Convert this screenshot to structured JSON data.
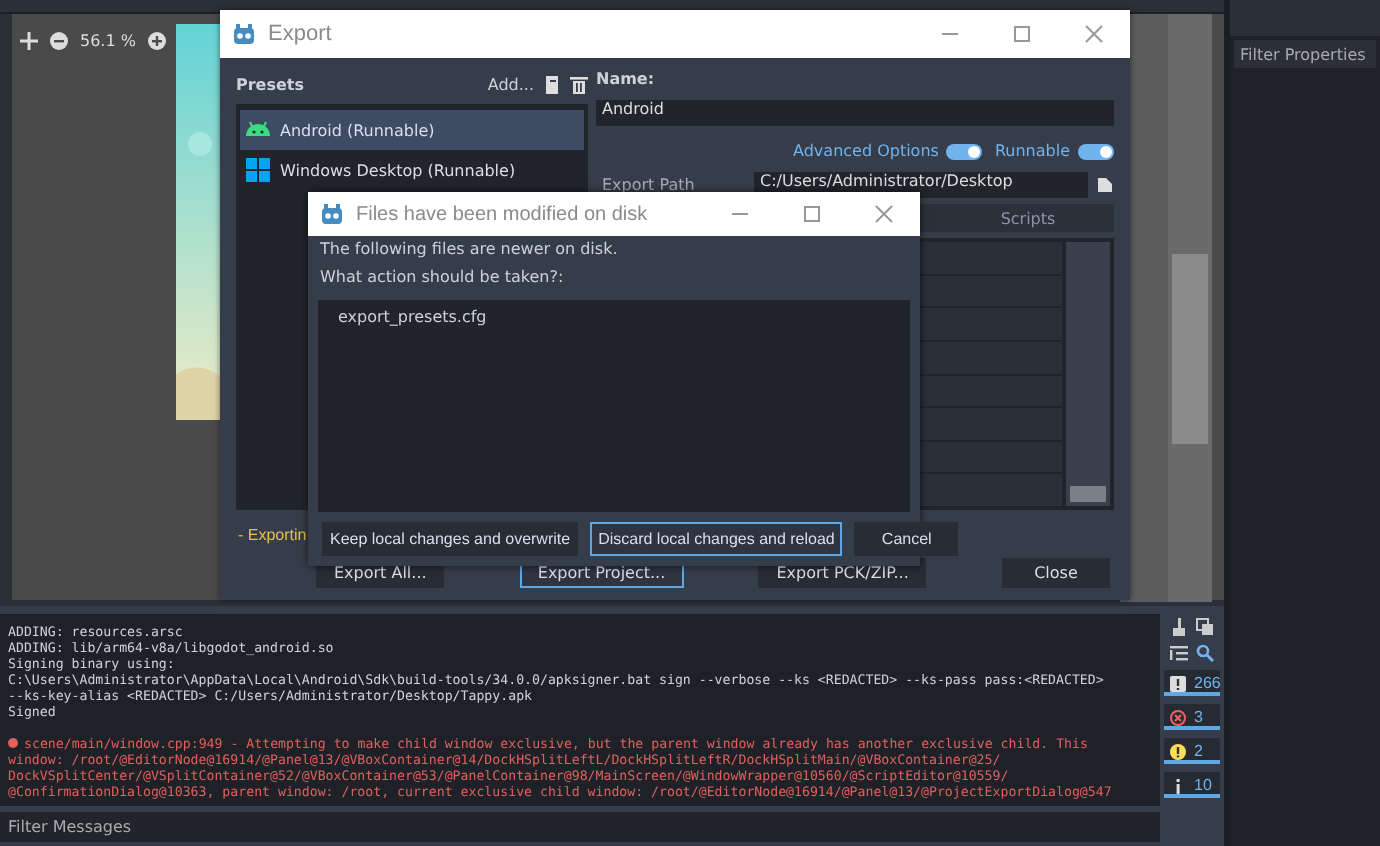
{
  "viewport": {
    "zoom": "56.1 %"
  },
  "inspector": {
    "filter_placeholder": "Filter Properties"
  },
  "export_window": {
    "title": "Export",
    "presets_label": "Presets",
    "add_label": "Add...",
    "presets": [
      {
        "name": "Android (Runnable)",
        "kind": "android",
        "selected": true
      },
      {
        "name": "Windows Desktop (Runnable)",
        "kind": "windows",
        "selected": false
      }
    ],
    "name_label": "Name:",
    "name_value": "Android",
    "options": [
      {
        "label": "Advanced Options",
        "on": true
      },
      {
        "label": "Runnable",
        "on": true
      }
    ],
    "export_path_label": "Export Path",
    "export_path": "C:/Users/Administrator/Desktop",
    "tabs": [
      {
        "label": "Scripts",
        "selected": false
      }
    ],
    "status": "- Exportin",
    "buttons": [
      {
        "label": "Export All...",
        "focused": false
      },
      {
        "label": "Export Project...",
        "focused": true
      },
      {
        "label": "Export PCK/ZIP...",
        "focused": false
      },
      {
        "label": "Close",
        "focused": false
      }
    ]
  },
  "dialog": {
    "title": "Files have been modified on disk",
    "message": "The following files are newer on disk.",
    "question": "What action should be taken?:",
    "files": [
      "export_presets.cfg"
    ],
    "buttons": [
      {
        "label": "Keep local changes and overwrite",
        "focused": false
      },
      {
        "label": "Discard local changes and reload",
        "focused": true
      },
      {
        "label": "Cancel",
        "focused": false
      }
    ]
  },
  "output": {
    "lines": [
      {
        "kind": "info",
        "text": "ADDING: resources.arsc"
      },
      {
        "kind": "info",
        "text": "ADDING: lib/arm64-v8a/libgodot_android.so"
      },
      {
        "kind": "info",
        "text": "Signing binary using:"
      },
      {
        "kind": "info",
        "text": "C:\\Users\\Administrator\\AppData\\Local\\Android\\Sdk\\build-tools/34.0.0/apksigner.bat sign --verbose --ks <REDACTED> --ks-pass pass:<REDACTED>"
      },
      {
        "kind": "info",
        "text": "--ks-key-alias <REDACTED> C:/Users/Administrator/Desktop/Tappy.apk"
      },
      {
        "kind": "info",
        "text": "Signed"
      },
      {
        "kind": "error",
        "text": "scene/main/window.cpp:949 - Attempting to make child window exclusive, but the parent window already has another exclusive child. This"
      },
      {
        "kind": "error_cont",
        "text": "window: /root/@EditorNode@16914/@Panel@13/@VBoxContainer@14/DockHSplitLeftL/DockHSplitLeftR/DockHSplitMain/@VBoxContainer@25/"
      },
      {
        "kind": "error_cont",
        "text": "DockVSplitCenter/@VSplitContainer@52/@VBoxContainer@53/@PanelContainer@98/MainScreen/@WindowWrapper@10560/@ScriptEditor@10559/"
      },
      {
        "kind": "error_cont",
        "text": "@ConfirmationDialog@10363, parent window: /root, current exclusive child window: /root/@EditorNode@16914/@Panel@13/@ProjectExportDialog@547"
      }
    ],
    "filter_placeholder": "Filter Messages",
    "counters": [
      {
        "kind": "message",
        "count": "266",
        "on": true
      },
      {
        "kind": "error",
        "count": "3",
        "on": true
      },
      {
        "kind": "warning",
        "count": "2",
        "on": true
      },
      {
        "kind": "info",
        "count": "10",
        "on": true
      }
    ]
  }
}
